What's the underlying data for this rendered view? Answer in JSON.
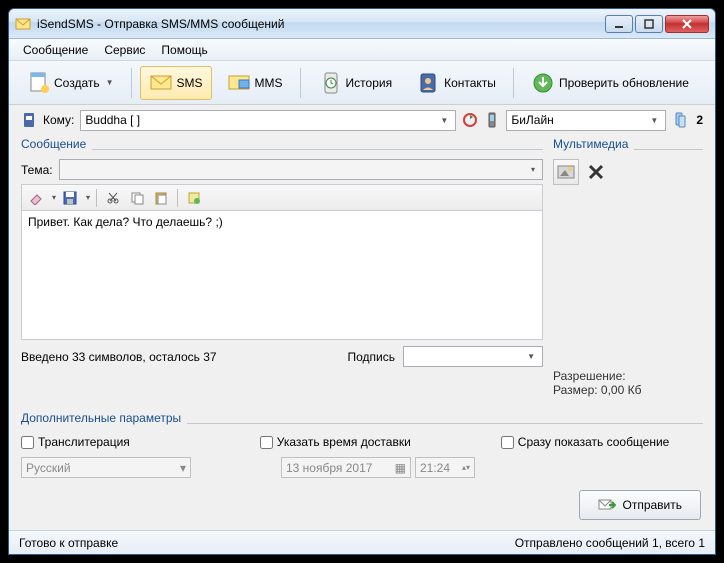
{
  "window": {
    "title": "iSendSMS - Отправка SMS/MMS сообщений"
  },
  "menu": {
    "message": "Сообщение",
    "service": "Сервис",
    "help": "Помощь"
  },
  "toolbar": {
    "create": "Создать",
    "sms": "SMS",
    "mms": "MMS",
    "history": "История",
    "contacts": "Контакты",
    "update": "Проверить обновление"
  },
  "address": {
    "to_label": "Кому:",
    "to_value": "Buddha [                      ]",
    "carrier": "БиЛайн",
    "count": "2"
  },
  "message": {
    "group": "Сообщение",
    "theme_label": "Тема:",
    "theme_value": "",
    "body": "Привет. Как дела? Что делаешь? ;)",
    "counter": "Введено 33 символов, осталось 37",
    "sign_label": "Подпись",
    "sign_value": ""
  },
  "multimedia": {
    "group": "Мультимедиа",
    "resolution": "Разрешение:",
    "size": "Размер: 0,00 Кб"
  },
  "extra": {
    "group": "Дополнительные параметры",
    "translit": "Транслитерация",
    "delivery": "Указать время доставки",
    "show_now": "Сразу показать сообщение",
    "lang": "Русский",
    "date": "13  ноября  2017",
    "time": "21:24"
  },
  "send": {
    "button": "Отправить"
  },
  "status": {
    "left": "Готово к отправке",
    "right": "Отправлено сообщений 1, всего 1"
  }
}
